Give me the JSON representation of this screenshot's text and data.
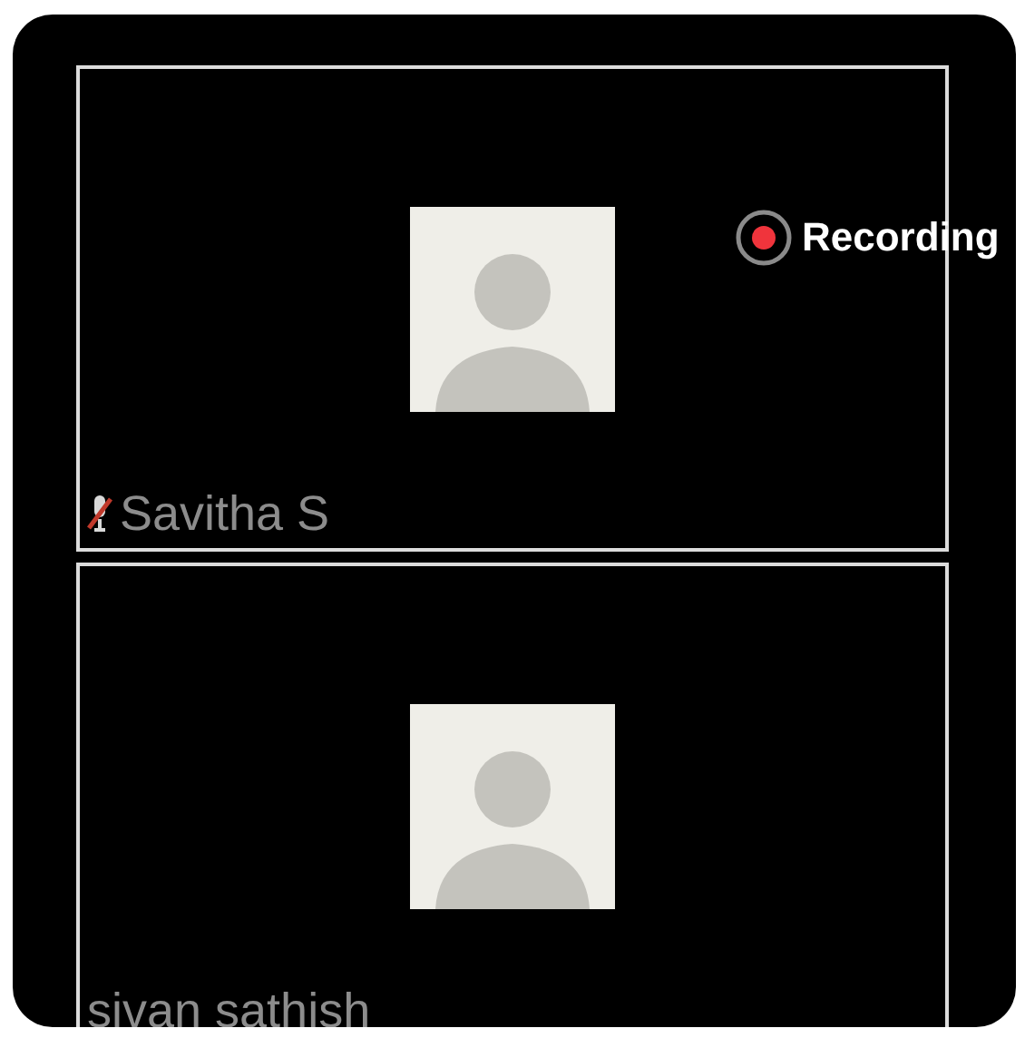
{
  "recording": {
    "label": "Recording"
  },
  "participants": [
    {
      "name": "Savitha S",
      "muted": true
    },
    {
      "name": "sivan sathish",
      "muted": false
    }
  ]
}
